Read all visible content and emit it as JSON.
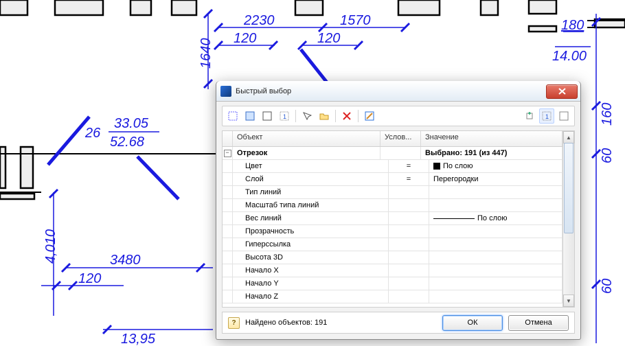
{
  "dialog": {
    "title": "Быстрый выбор",
    "columns": {
      "object": "Объект",
      "condition": "Услов...",
      "value": "Значение"
    },
    "header_row": {
      "name": "Отрезок",
      "value_prefix": "Выбрано:",
      "value_count": "191",
      "value_of": "(из 447)"
    },
    "rows": [
      {
        "name": "Цвет",
        "cond": "=",
        "value": "По слою",
        "swatch": true
      },
      {
        "name": "Слой",
        "cond": "=",
        "value": "Перегородки"
      },
      {
        "name": "Тип линий",
        "cond": "",
        "value": ""
      },
      {
        "name": "Масштаб типа линий",
        "cond": "",
        "value": ""
      },
      {
        "name": "Вес линий",
        "cond": "",
        "value": "По слою",
        "ltype": true
      },
      {
        "name": "Прозрачность",
        "cond": "",
        "value": ""
      },
      {
        "name": "Гиперссылка",
        "cond": "",
        "value": ""
      },
      {
        "name": "Высота 3D",
        "cond": "",
        "value": ""
      },
      {
        "name": "Начало X",
        "cond": "",
        "value": ""
      },
      {
        "name": "Начало Y",
        "cond": "",
        "value": ""
      },
      {
        "name": "Начало Z",
        "cond": "",
        "value": ""
      }
    ],
    "status": "Найдено объектов: 191",
    "ok": "ОК",
    "cancel": "Отмена"
  },
  "cad_labels": {
    "d2230": "2230",
    "d1570": "1570",
    "d120a": "120",
    "d120b": "120",
    "d1640": "1640",
    "d26": "26",
    "d3305": "33.05",
    "d5268": "52.68",
    "u180": "180",
    "u1400": "14.00",
    "u160": "160",
    "u60a": "60",
    "u60b": "60",
    "d4010": "4,010",
    "d3480": "3480",
    "d120c": "120",
    "d1395": "13,95"
  }
}
